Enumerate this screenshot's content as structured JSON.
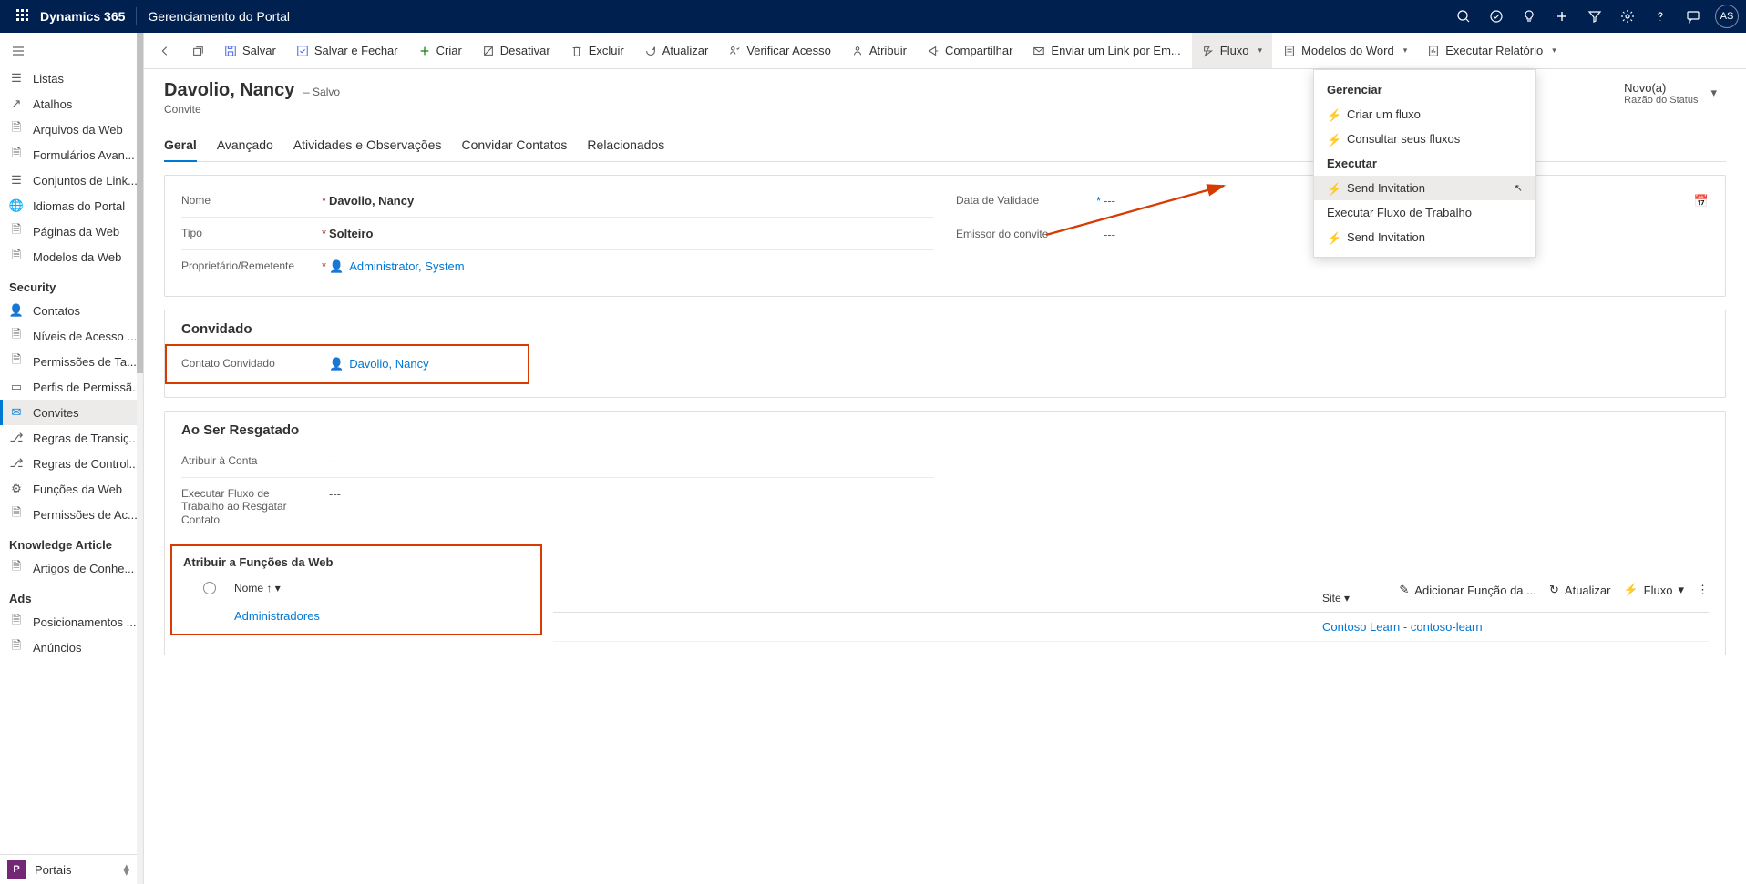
{
  "topbar": {
    "brand": "Dynamics 365",
    "app": "Gerenciamento do Portal",
    "avatar": "AS"
  },
  "sidebar": {
    "items_general": [
      {
        "label": "Listas",
        "icon": "list"
      },
      {
        "label": "Atalhos",
        "icon": "shortcut"
      },
      {
        "label": "Arquivos da Web",
        "icon": "file"
      },
      {
        "label": "Formulários Avan...",
        "icon": "file"
      },
      {
        "label": "Conjuntos de Link...",
        "icon": "list"
      },
      {
        "label": "Idiomas do Portal",
        "icon": "globe"
      },
      {
        "label": "Páginas da Web",
        "icon": "page"
      },
      {
        "label": "Modelos da Web",
        "icon": "file"
      }
    ],
    "header_security": "Security",
    "items_security": [
      {
        "label": "Contatos",
        "icon": "person"
      },
      {
        "label": "Níveis de Acesso ...",
        "icon": "file"
      },
      {
        "label": "Permissões de Ta...",
        "icon": "file"
      },
      {
        "label": "Perfis de Permissã...",
        "icon": "card"
      },
      {
        "label": "Convites",
        "icon": "invite",
        "active": true
      },
      {
        "label": "Regras de Transiç...",
        "icon": "branch"
      },
      {
        "label": "Regras de Control...",
        "icon": "branch"
      },
      {
        "label": "Funções da Web",
        "icon": "gear"
      },
      {
        "label": "Permissões de Ac...",
        "icon": "file"
      }
    ],
    "header_knowledge": "Knowledge Article",
    "items_knowledge": [
      {
        "label": "Artigos de Conhe...",
        "icon": "file"
      }
    ],
    "header_ads": "Ads",
    "items_ads": [
      {
        "label": "Posicionamentos ...",
        "icon": "file"
      },
      {
        "label": "Anúncios",
        "icon": "file"
      }
    ],
    "footer_badge": "P",
    "footer_label": "Portais"
  },
  "commandbar": {
    "save": "Salvar",
    "saveclose": "Salvar e Fechar",
    "create": "Criar",
    "deactivate": "Desativar",
    "delete": "Excluir",
    "refresh": "Atualizar",
    "checkaccess": "Verificar Acesso",
    "assign": "Atribuir",
    "share": "Compartilhar",
    "emaillink": "Enviar um Link por Em...",
    "flow": "Fluxo",
    "wordtemplates": "Modelos do Word",
    "runreport": "Executar Relatório"
  },
  "record": {
    "title": "Davolio, Nancy",
    "saved": "– Salvo",
    "entity": "Convite",
    "status_value": "Novo(a)",
    "status_label": "Razão do Status"
  },
  "tabs": {
    "general": "Geral",
    "advanced": "Avançado",
    "activities": "Atividades e Observações",
    "invite": "Convidar Contatos",
    "related": "Relacionados"
  },
  "fields": {
    "name_label": "Nome",
    "name_value": "Davolio, Nancy",
    "type_label": "Tipo",
    "type_value": "Solteiro",
    "owner_label": "Proprietário/Remetente",
    "owner_value": "Administrator, System",
    "expiry_label": "Data de Validade",
    "expiry_value": "---",
    "inviter_label": "Emissor do convite",
    "inviter_value": "---"
  },
  "invited": {
    "section": "Convidado",
    "contact_label": "Contato Convidado",
    "contact_value": "Davolio, Nancy"
  },
  "redemption": {
    "section": "Ao Ser Resgatado",
    "account_label": "Atribuir à Conta",
    "account_value": "---",
    "workflow_label": "Executar Fluxo de Trabalho ao Resgatar Contato",
    "workflow_value": "---",
    "webroles_section": "Atribuir a Funções da Web",
    "grid_add": "Adicionar Função da ...",
    "grid_refresh": "Atualizar",
    "grid_flow": "Fluxo",
    "col_name": "Nome",
    "col_site": "Site",
    "row_name": "Administradores",
    "row_site": "Contoso Learn - contoso-learn"
  },
  "flowmenu": {
    "header_manage": "Gerenciar",
    "create": "Criar um fluxo",
    "view": "Consultar seus fluxos",
    "header_run": "Executar",
    "send": "Send Invitation",
    "runwf": "Executar Fluxo de Trabalho",
    "send2": "Send Invitation"
  }
}
